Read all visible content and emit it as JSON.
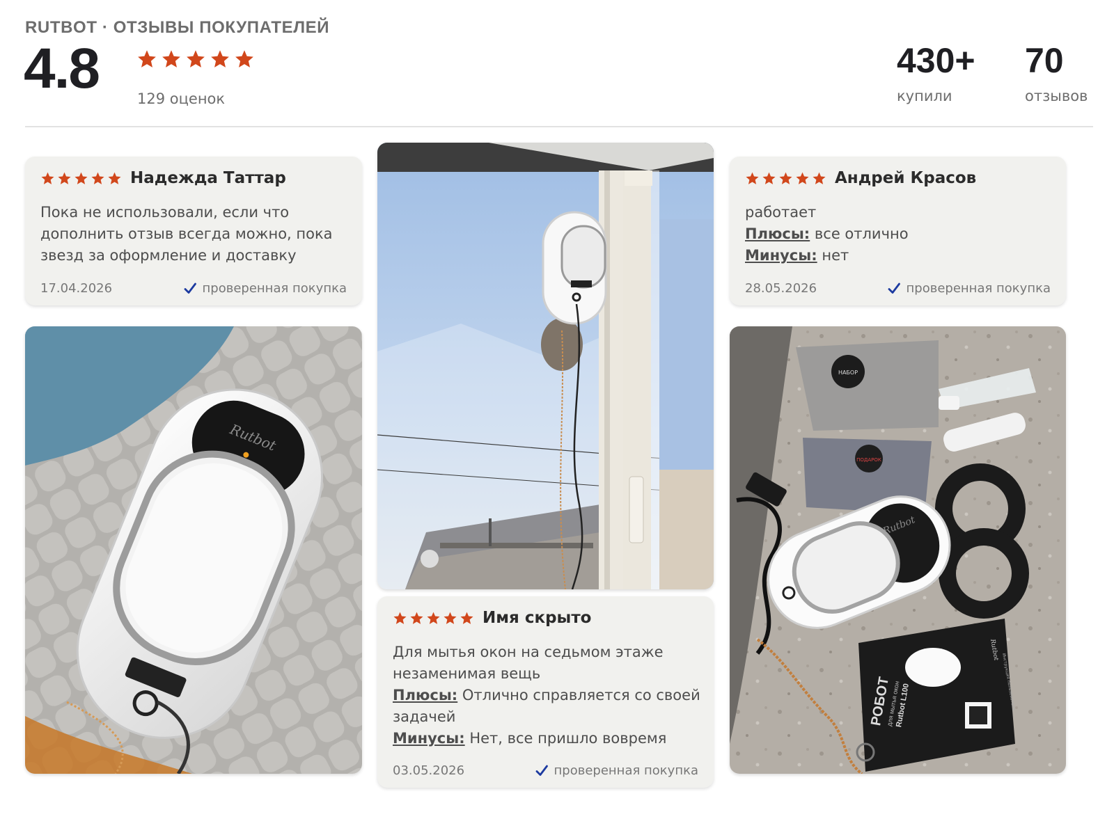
{
  "header": {
    "brand": "RUTBOT · ОТЗЫВЫ ПОКУПАТЕЛЕЙ",
    "rating": "4.8",
    "stars": 5,
    "rating_count": "129 оценок",
    "bought_value": "430+",
    "bought_label": "купили",
    "reviews_value": "70",
    "reviews_label": "отзывов"
  },
  "colors": {
    "star": "#d1471b",
    "check": "#1c3aa0",
    "card_bg": "#f1f1ee"
  },
  "icons": {
    "star": "star-icon",
    "verified": "checkmark-icon"
  },
  "reviews": [
    {
      "author": "Надежда Таттар",
      "stars": 5,
      "text": "Пока не использовали, если что дополнить отзыв всегда можно, пока звезд за оформление и доставку",
      "date": "17.04.2026",
      "verified": "проверенная покупка"
    },
    {
      "author": "Андрей Красов",
      "stars": 5,
      "text": "работает",
      "pros_label": "Плюсы:",
      "pros": "все отлично",
      "cons_label": "Минусы:",
      "cons": "нет",
      "date": "28.05.2026",
      "verified": "проверенная покупка"
    },
    {
      "author": "Имя скрыто",
      "stars": 5,
      "text": "Для мытья окон на седьмом этаже незаменимая вещь",
      "pros_label": "Плюсы:",
      "pros": "Отлично справляется со своей задачей",
      "cons_label": "Минусы:",
      "cons": "Нет, все пришло вовремя",
      "date": "03.05.2026",
      "verified": "проверенная покупка"
    }
  ],
  "photos": {
    "robot_logo": "Rutbot",
    "box_title": "РОБОТ",
    "box_subtitle": "для мытья окон",
    "box_model": "Rutbot L100",
    "box_brand": "Rutbot",
    "box_manual": "Инструкция пользователя",
    "bag_label": "НАБОР",
    "gloves_label": "ПОДАРОК"
  }
}
